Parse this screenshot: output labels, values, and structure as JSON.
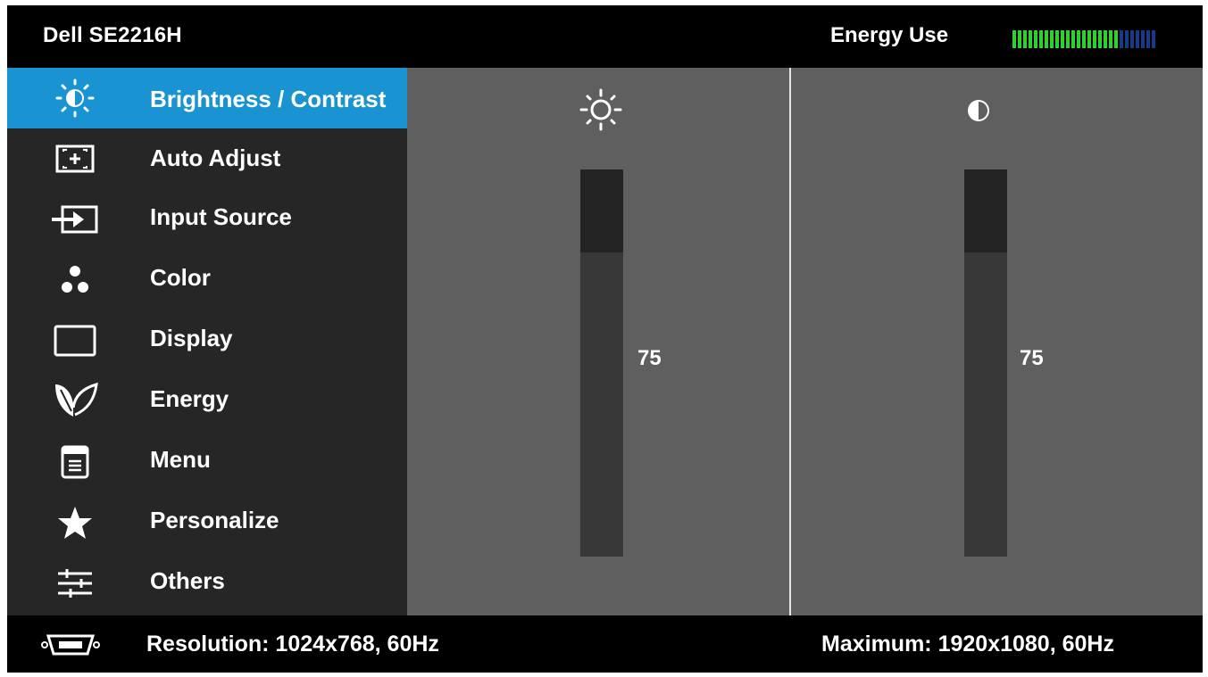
{
  "header": {
    "model": "Dell SE2216H",
    "energy_label": "Energy Use",
    "energy_meter": {
      "filled_segments": 20,
      "total_segments": 27,
      "fill_color": "#2fd12f",
      "empty_color": "#1b3a86"
    }
  },
  "menu": {
    "items": [
      {
        "label": "Brightness / Contrast",
        "icon": "brightness-contrast-icon",
        "selected": true
      },
      {
        "label": "Auto Adjust",
        "icon": "auto-adjust-icon",
        "selected": false
      },
      {
        "label": "Input Source",
        "icon": "input-source-icon",
        "selected": false
      },
      {
        "label": "Color",
        "icon": "color-icon",
        "selected": false
      },
      {
        "label": "Display",
        "icon": "display-icon",
        "selected": false
      },
      {
        "label": "Energy",
        "icon": "energy-leaf-icon",
        "selected": false
      },
      {
        "label": "Menu",
        "icon": "menu-icon",
        "selected": false
      },
      {
        "label": "Personalize",
        "icon": "star-icon",
        "selected": false
      },
      {
        "label": "Others",
        "icon": "sliders-icon",
        "selected": false
      }
    ],
    "selected_color": "#1a93d2"
  },
  "brightness": {
    "icon": "sun-icon",
    "value": "75",
    "level": 0.75
  },
  "contrast": {
    "icon": "contrast-icon",
    "value": "75",
    "level": 0.75
  },
  "footer": {
    "connector_icon": "vga-connector-icon",
    "resolution": "Resolution: 1024x768, 60Hz",
    "maximum": "Maximum: 1920x1080, 60Hz"
  }
}
